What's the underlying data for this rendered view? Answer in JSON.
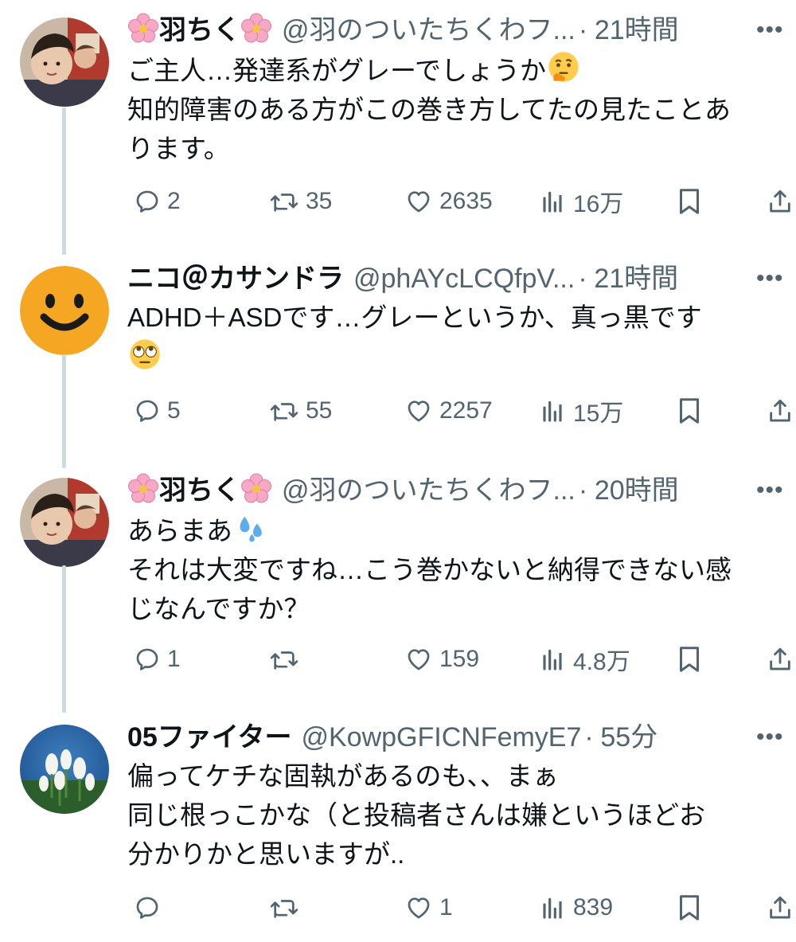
{
  "tweets": [
    {
      "name": "🌸羽ちく🌸",
      "handle": "@羽のついたちくわフ...",
      "time": "21時間",
      "lines": [
        "ご主人…発達系がグレーでしょうか",
        "知的障害のある方がこの巻き方してたの見たことあ",
        "ります。"
      ],
      "emoji": "thinking-face",
      "reply": "2",
      "retweet": "35",
      "like": "2635",
      "views": "16万",
      "avatar": "photo-person"
    },
    {
      "name": "ニコ＠カサンドラ",
      "handle": "@phAYcLCQfpV...",
      "time": "21時間",
      "lines": [
        "ADHD＋ASDです…グレーというか、真っ黒です",
        ""
      ],
      "emoji": "rolling-eyes-face",
      "reply": "5",
      "retweet": "55",
      "like": "2257",
      "views": "15万",
      "avatar": "smiley-face"
    },
    {
      "name": "🌸羽ちく🌸",
      "handle": "@羽のついたちくわフ...",
      "time": "20時間",
      "lines": [
        "あらまあ",
        "それは大変ですね…こう巻かないと納得できない感",
        "じなんですか？"
      ],
      "emoji": "sweat-droplets",
      "reply": "1",
      "retweet": "",
      "like": "159",
      "views": "4.8万",
      "avatar": "photo-person"
    },
    {
      "name": "05ファイター",
      "handle": "@KowpGFICNFemyE7",
      "time": "55分",
      "lines": [
        "偏ってケチな固執があるのも、、まぁ",
        "同じ根っこかな（と投稿者さんは嫌というほどお",
        "分かりかと思いますが.."
      ],
      "emoji": "",
      "reply": "",
      "retweet": "",
      "like": "1",
      "views": "839",
      "avatar": "photo-flowers"
    }
  ],
  "separator": "·",
  "more_glyph": "•••",
  "colors": {
    "text": "#0f1419",
    "muted": "#536471",
    "thread_line": "#cfd9de"
  }
}
